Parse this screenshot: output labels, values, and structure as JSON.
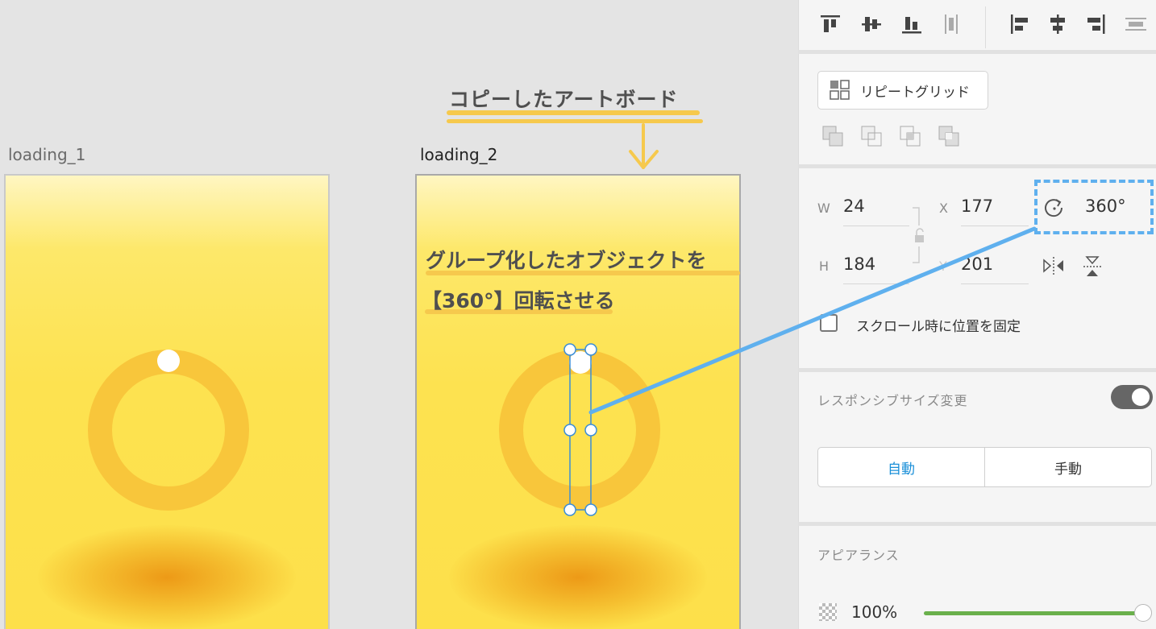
{
  "canvas": {
    "artboard_1": {
      "label": "loading_1"
    },
    "artboard_2": {
      "label": "loading_2"
    },
    "annotation_copy": "コピーしたアートボード",
    "annotation_rotate_line1": "グループ化したオブジェクトを",
    "annotation_rotate_line2": "【360°】回転させる"
  },
  "panel": {
    "align_icons": [
      "align-top-icon",
      "align-middle-icon",
      "align-bottom-icon",
      "distribute-vertical-icon",
      "align-left-icon",
      "align-center-icon",
      "align-right-icon",
      "distribute-horizontal-icon"
    ],
    "repeat_grid_label": "リピートグリッド",
    "transform": {
      "w_label": "W",
      "w_value": "24",
      "h_label": "H",
      "h_value": "184",
      "x_label": "X",
      "x_value": "177",
      "y_label": "Y",
      "y_value": "201",
      "rotation_value": "360°"
    },
    "fix_scroll_label": "スクロール時に位置を固定",
    "responsive_resize": {
      "label": "レスポンシブサイズ変更",
      "enabled": true,
      "options": [
        "自動",
        "手動"
      ],
      "selected": "自動"
    },
    "appearance": {
      "label": "アピアランス",
      "opacity": "100%"
    }
  },
  "colors": {
    "artboard_yellow": "#fde250",
    "ring": "#f8c63b",
    "highlight": "#f6c94d",
    "connector_blue": "#5fb0ee",
    "selection_blue": "#3a8dd8",
    "slider_green": "#6ab04c",
    "link_blue": "#1a8fd8"
  }
}
